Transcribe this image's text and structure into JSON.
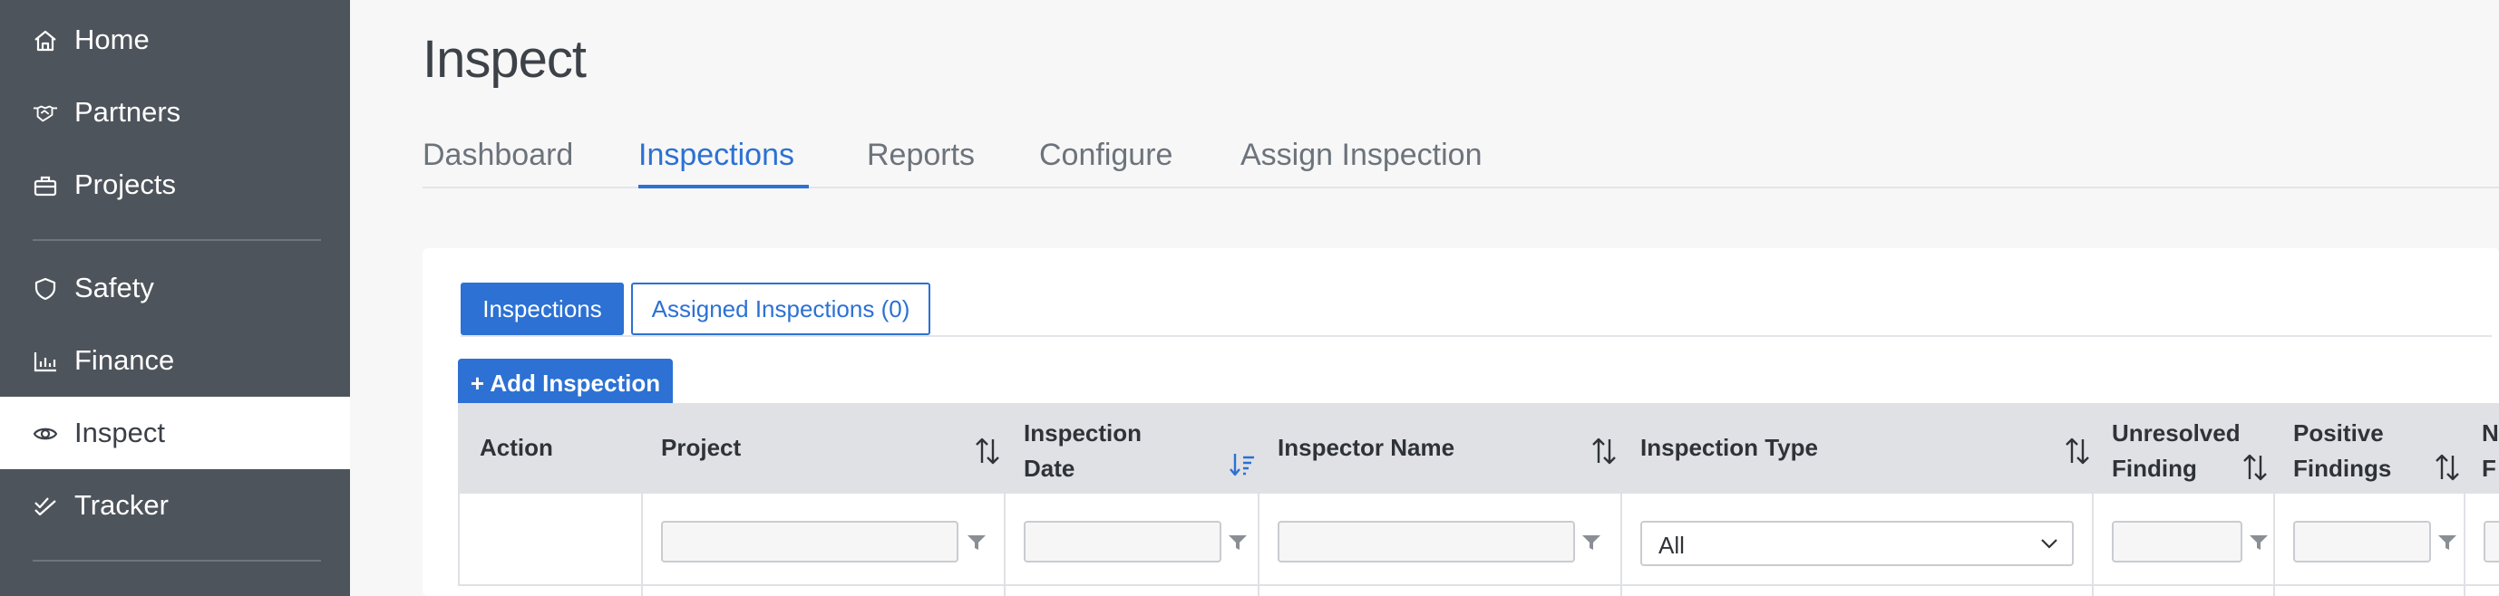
{
  "sidebar": {
    "items": [
      {
        "label": "Home",
        "icon": "home-icon"
      },
      {
        "label": "Partners",
        "icon": "handshake-icon"
      },
      {
        "label": "Projects",
        "icon": "briefcase-icon"
      },
      {
        "label": "Safety",
        "icon": "shield-icon"
      },
      {
        "label": "Finance",
        "icon": "bar-chart-icon"
      },
      {
        "label": "Inspect",
        "icon": "eye-icon",
        "active": true
      },
      {
        "label": "Tracker",
        "icon": "check-double-icon"
      }
    ]
  },
  "page": {
    "title": "Inspect",
    "tabs": [
      {
        "label": "Dashboard"
      },
      {
        "label": "Inspections",
        "active": true
      },
      {
        "label": "Reports"
      },
      {
        "label": "Configure"
      },
      {
        "label": "Assign Inspection"
      }
    ]
  },
  "card": {
    "subtabs": [
      {
        "label": "Inspections",
        "active": true
      },
      {
        "label": "Assigned Inspections (0)"
      }
    ],
    "add_button": "+ Add Inspection",
    "table": {
      "columns": [
        {
          "label": "Action"
        },
        {
          "label": "Project",
          "sortable": true
        },
        {
          "label_line1": "Inspection",
          "label_line2": "Date",
          "sortable": true,
          "sort": "descending"
        },
        {
          "label": "Inspector Name",
          "sortable": true
        },
        {
          "label": "Inspection Type",
          "sortable": true
        },
        {
          "label_line1": "Unresolved",
          "label_line2": "Finding",
          "sortable": true
        },
        {
          "label_line1": "Positive",
          "label_line2": "Findings",
          "sortable": true
        },
        {
          "label_line1": "N",
          "label_line2": "F"
        }
      ],
      "filters": {
        "inspection_type_selected": "All"
      }
    }
  },
  "colors": {
    "sidebar_bg": "#4e545b",
    "accent": "#2c71d3",
    "header_bg": "#dfe1e5"
  }
}
